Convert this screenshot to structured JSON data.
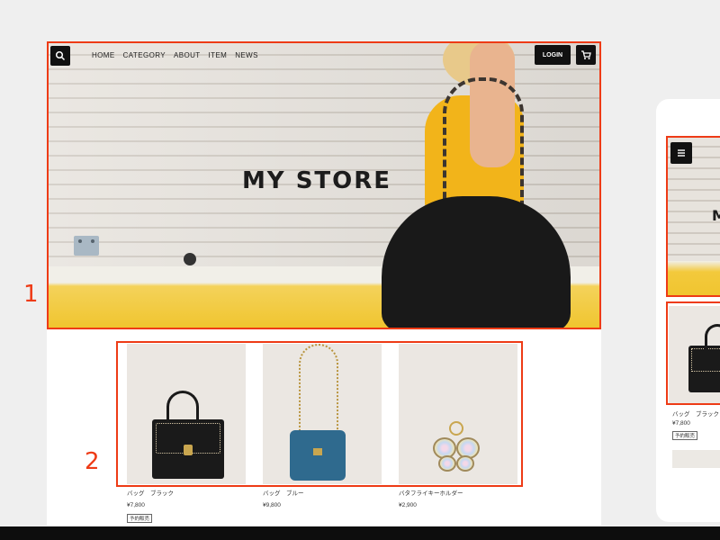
{
  "header": {
    "nav_items": [
      "HOME",
      "CATEGORY",
      "ABOUT",
      "ITEM",
      "NEWS"
    ],
    "login_label": "LOGIN"
  },
  "hero": {
    "title": "MY STORE"
  },
  "products": [
    {
      "name": "バッグ　ブラック",
      "price": "¥7,800",
      "tag": "予約販売"
    },
    {
      "name": "バッグ　ブルー",
      "price": "¥9,800",
      "tag": ""
    },
    {
      "name": "バタフライキーホルダー",
      "price": "¥2,900",
      "tag": ""
    }
  ],
  "annotations": {
    "section1": "1",
    "section2": "2"
  },
  "mobile": {
    "hero_title": "M",
    "product": {
      "name": "バッグ　ブラック",
      "price": "¥7,800",
      "tag": "予約販売"
    }
  },
  "colors": {
    "annotation": "#ee3b16",
    "button": "#111111",
    "accent_yellow": "#f0c52f"
  },
  "icons": {
    "search": "search-icon",
    "cart": "cart-icon",
    "menu": "hamburger-menu-icon"
  }
}
